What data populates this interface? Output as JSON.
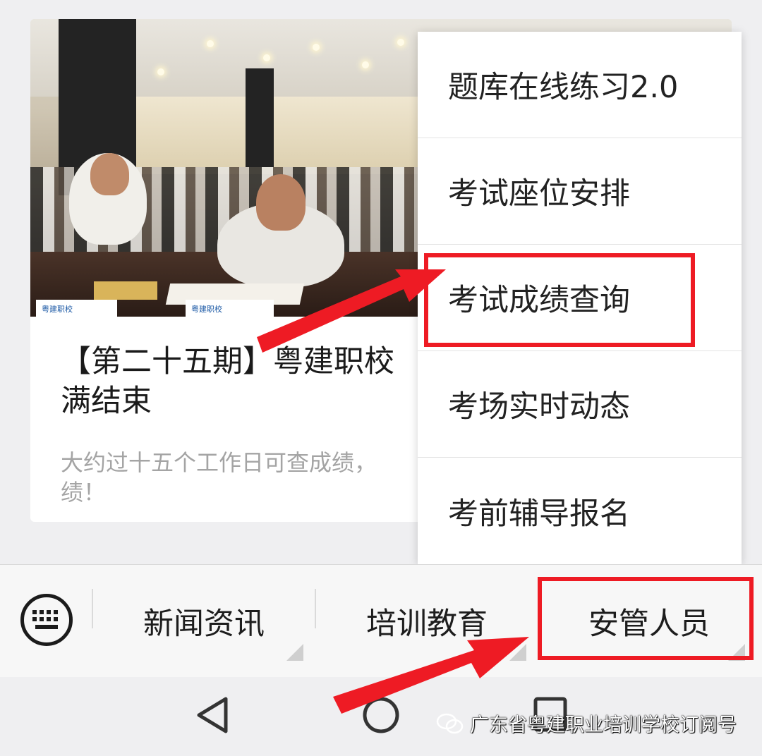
{
  "article": {
    "title": "【第二十五期】粤建职校\n满结束",
    "description": "大约过十五个工作日可查成绩，\n绩！",
    "photo_sign_text": "粤建职校"
  },
  "menu": {
    "items": [
      {
        "label": "题库在线练习2.0"
      },
      {
        "label": "考试座位安排"
      },
      {
        "label": "考试成绩查询"
      },
      {
        "label": "考场实时动态"
      },
      {
        "label": "考前辅导报名"
      }
    ]
  },
  "menubar": {
    "tabs": [
      {
        "label": "新闻资讯"
      },
      {
        "label": "培训教育"
      },
      {
        "label": "安管人员"
      }
    ]
  },
  "watermark": {
    "text": "广东省粤建职业培训学校订阅号"
  },
  "colors": {
    "highlight": "#ee1b24",
    "menubar_bg": "#f7f7f7",
    "page_bg": "#efeff1"
  },
  "icons": [
    "keyboard-icon",
    "back-icon",
    "home-icon",
    "recents-icon",
    "wechat-icon"
  ]
}
